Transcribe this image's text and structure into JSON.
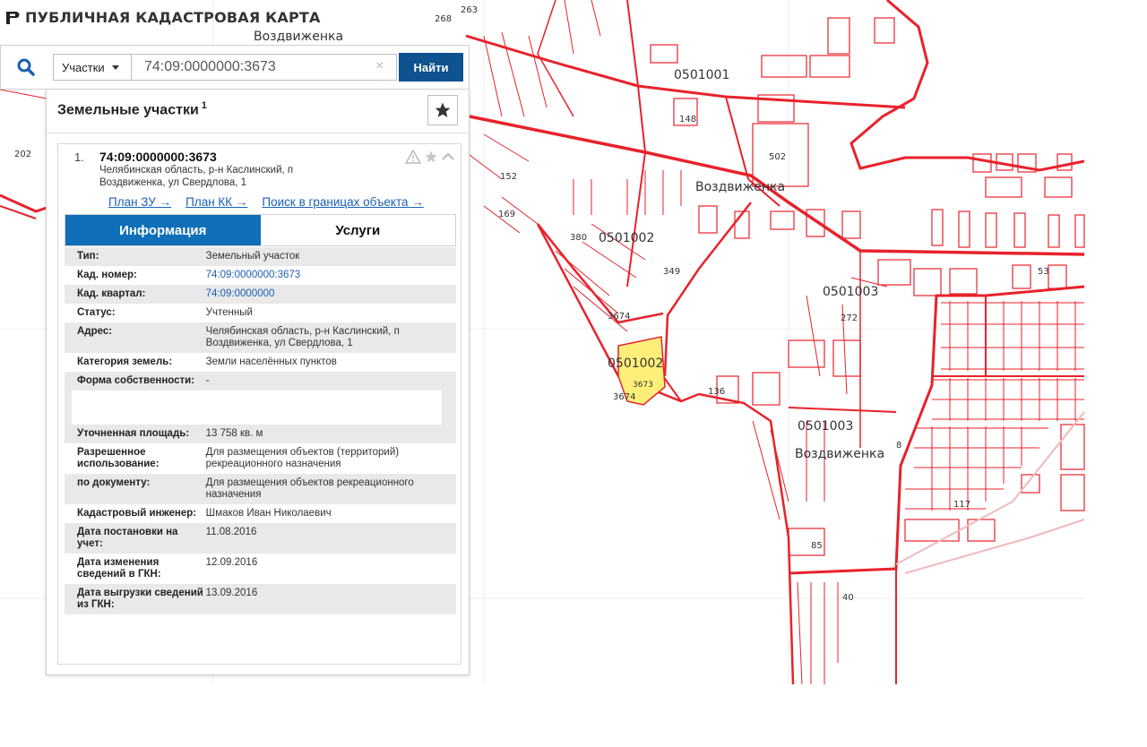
{
  "app": {
    "title": "ПУБЛИЧНАЯ КАДАСТРОВАЯ КАРТА"
  },
  "search": {
    "category": "Участки",
    "query": "74:09:0000000:3673",
    "clear": "×",
    "submit": "Найти"
  },
  "panel": {
    "title": "Земельные участки",
    "count": "1"
  },
  "result": {
    "index": "1.",
    "cad_number": "74:09:0000000:3673",
    "address": "Челябинская область, р-н Каслинский, п Воздвиженка, ул Свердлова, 1",
    "links": {
      "plan_zu": "План ЗУ →",
      "plan_kk": "План КК →",
      "search_in_bounds": "Поиск в границах объекта →"
    },
    "tabs": {
      "info": "Информация",
      "services": "Услуги"
    },
    "fields": [
      {
        "k": "Тип:",
        "v": "Земельный участок"
      },
      {
        "k": "Кад. номер:",
        "v": "74:09:0000000:3673"
      },
      {
        "k": "Кад. квартал:",
        "v": "74:09:0000000"
      },
      {
        "k": "Статус:",
        "v": "Учтенный"
      },
      {
        "k": "Адрес:",
        "v": "Челябинская область, р-н Каслинский, п Воздвиженка, ул Свердлова, 1"
      },
      {
        "k": "Категория земель:",
        "v": "Земли населённых пунктов"
      },
      {
        "k": "Форма собственности:",
        "v": "-"
      },
      {
        "k": "Уточненная площадь:",
        "v": "13 758 кв. м"
      },
      {
        "k": "Разрешенное использование:",
        "v": "Для размещения объектов (территорий) рекреационного назначения"
      },
      {
        "k": "по документу:",
        "v": "Для размещения объектов рекреационного назначения"
      },
      {
        "k": "Кадастровый инженер:",
        "v": "Шмаков Иван Николаевич"
      },
      {
        "k": "Дата постановки на учет:",
        "v": "11.08.2016"
      },
      {
        "k": "Дата изменения сведений в ГКН:",
        "v": "12.09.2016"
      },
      {
        "k": "Дата выгрузки сведений из ГКН:",
        "v": "13.09.2016"
      }
    ]
  },
  "map": {
    "labels": {
      "place_top": "Воздвиженка",
      "place_mid": "Воздвиженка",
      "place_low": "Воздвиженка",
      "q1": "0501001",
      "q2": "0501002",
      "q3": "0501003",
      "q3b": "0501003",
      "q2_parcel": "0501002",
      "n502": "502",
      "n202": "202",
      "n148": "148",
      "n152": "152",
      "n169": "169",
      "n380": "380",
      "n349": "349",
      "n3674a": "3674",
      "n3674b": "3674",
      "n3673": "3673",
      "n136": "136",
      "n272": "272",
      "n53": "53",
      "n117": "117",
      "n40": "40",
      "n8": "8",
      "n85": "85",
      "n268": "268",
      "n263": "263"
    },
    "colors": {
      "boundary": "#e8222b",
      "highlight": "#ffef7a",
      "bg": "#ffffff"
    }
  }
}
